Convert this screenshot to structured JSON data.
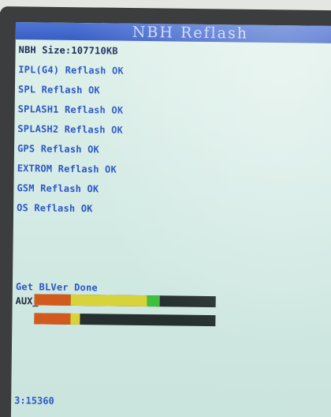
{
  "header": {
    "title": "NBH  Reflash"
  },
  "log": [
    "NBH Size:107710KB",
    "IPL(G4) Reflash OK",
    "SPL Reflash OK",
    "SPLASH1 Reflash OK",
    "SPLASH2 Reflash OK",
    "GPS Reflash OK",
    "EXTROM Reflash OK",
    "GSM Reflash OK",
    "OS Reflash OK"
  ],
  "status": {
    "blver": "Get BLVer Done",
    "aux": "AUX_Process Called OK",
    "bottom": "3:15360"
  },
  "progress": {
    "top_bar": {
      "red": 0.2,
      "yellow": 0.42,
      "green": 0.07
    },
    "bottom_bar": {
      "red": 0.2,
      "yellow": 0.05
    }
  },
  "colors": {
    "text_blue": "#2a56c6",
    "title_bar": "#4a6fd6",
    "screen_bg": "#d5ebe5",
    "bar_bg": "#26302e",
    "bar_red": "#d25a1c",
    "bar_yellow": "#d8d33a",
    "bar_green": "#3fbf3f"
  }
}
